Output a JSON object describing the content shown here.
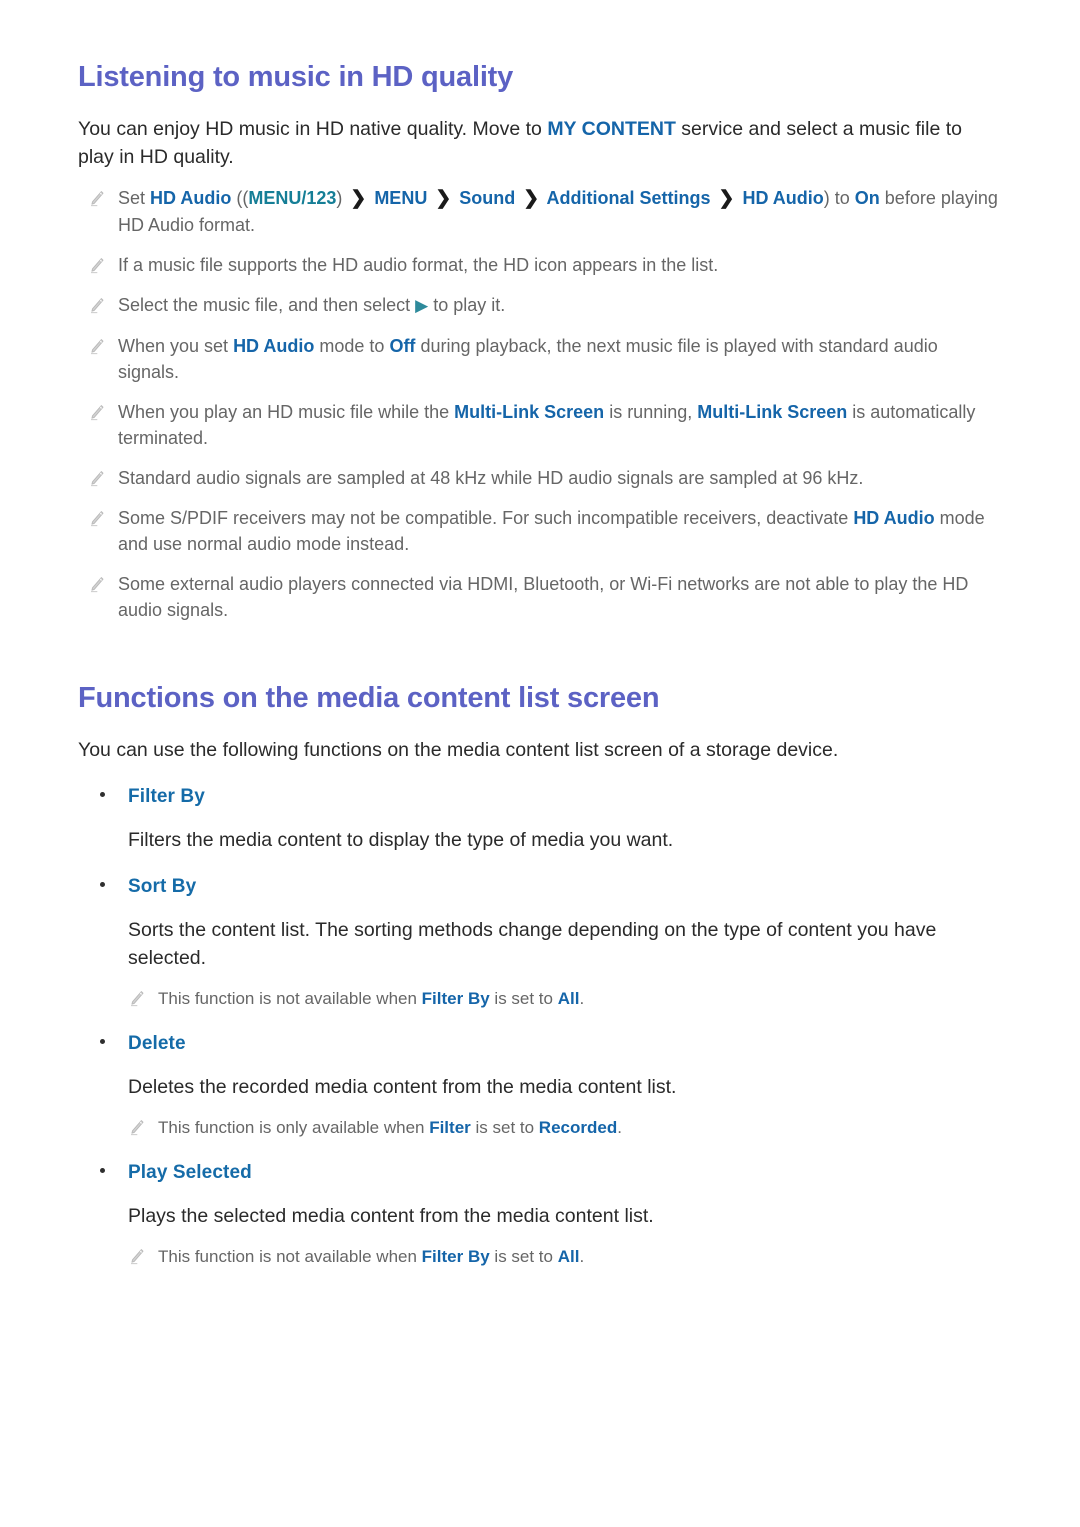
{
  "document": {
    "sections": [
      {
        "id": "listening-hd",
        "title": "Listening to music in HD quality",
        "intro_pre": "You can enjoy HD music in HD native quality. Move to ",
        "intro_kw": "MY CONTENT",
        "intro_post": " service and select a music file to play in HD quality.",
        "notes": [
          {
            "id": "note-set-hd-audio",
            "segments": [
              {
                "t": "Set ",
                "s": "plain"
              },
              {
                "t": "HD Audio",
                "s": "kw"
              },
              {
                "t": " ((",
                "s": "plain"
              },
              {
                "t": "MENU/123",
                "s": "kw-teal"
              },
              {
                "t": ") ",
                "s": "plain"
              },
              {
                "t": "❯",
                "s": "chev"
              },
              {
                "t": " MENU",
                "s": "kw"
              },
              {
                "t": " ",
                "s": "plain"
              },
              {
                "t": "❯",
                "s": "chev"
              },
              {
                "t": " Sound",
                "s": "kw"
              },
              {
                "t": " ",
                "s": "plain"
              },
              {
                "t": "❯",
                "s": "chev"
              },
              {
                "t": " Additional Settings",
                "s": "kw"
              },
              {
                "t": " ",
                "s": "plain"
              },
              {
                "t": "❯",
                "s": "chev"
              },
              {
                "t": " HD Audio",
                "s": "kw"
              },
              {
                "t": ") to ",
                "s": "plain"
              },
              {
                "t": "On",
                "s": "kw"
              },
              {
                "t": " before playing HD Audio format.",
                "s": "plain"
              }
            ]
          },
          {
            "id": "note-hd-icon",
            "segments": [
              {
                "t": "If a music file supports the HD audio format, the HD icon appears in the list.",
                "s": "plain"
              }
            ]
          },
          {
            "id": "note-select-play",
            "segments": [
              {
                "t": "Select the music file, and then select ",
                "s": "plain"
              },
              {
                "t": "▶",
                "s": "play-tri"
              },
              {
                "t": " to play it.",
                "s": "plain"
              }
            ]
          },
          {
            "id": "note-hd-audio-off",
            "segments": [
              {
                "t": "When you set ",
                "s": "plain"
              },
              {
                "t": "HD Audio",
                "s": "kw"
              },
              {
                "t": " mode to ",
                "s": "plain"
              },
              {
                "t": "Off",
                "s": "kw"
              },
              {
                "t": " during playback, the next music file is played with standard audio signals.",
                "s": "plain"
              }
            ]
          },
          {
            "id": "note-multi-link-screen",
            "segments": [
              {
                "t": "When you play an HD music file while the ",
                "s": "plain"
              },
              {
                "t": "Multi-Link Screen",
                "s": "kw"
              },
              {
                "t": " is running, ",
                "s": "plain"
              },
              {
                "t": "Multi-Link Screen",
                "s": "kw"
              },
              {
                "t": " is automatically terminated.",
                "s": "plain"
              }
            ]
          },
          {
            "id": "note-sampling-rates",
            "segments": [
              {
                "t": "Standard audio signals are sampled at 48 kHz while HD audio signals are sampled at 96 kHz.",
                "s": "plain"
              }
            ]
          },
          {
            "id": "note-spdif",
            "segments": [
              {
                "t": "Some S/PDIF receivers may not be compatible. For such incompatible receivers, deactivate ",
                "s": "plain"
              },
              {
                "t": "HD Audio",
                "s": "kw"
              },
              {
                "t": " mode and use normal audio mode instead.",
                "s": "plain"
              }
            ]
          },
          {
            "id": "note-external-players",
            "segments": [
              {
                "t": "Some external audio players connected via HDMI, Bluetooth, or Wi-Fi networks are not able to play the HD audio signals.",
                "s": "plain"
              }
            ]
          }
        ]
      },
      {
        "id": "media-content-functions",
        "title": "Functions on the media content list screen",
        "intro": "You can use the following functions on the media content list screen of a storage device.",
        "items": [
          {
            "id": "filter-by",
            "label": "Filter By",
            "description": "Filters the media content to display the type of media you want.",
            "notes": []
          },
          {
            "id": "sort-by",
            "label": "Sort By",
            "description": "Sorts the content list. The sorting methods change depending on the type of content you have selected.",
            "notes": [
              {
                "id": "note-sort-by-all",
                "segments": [
                  {
                    "t": "This function is not available when ",
                    "s": "plain"
                  },
                  {
                    "t": "Filter By",
                    "s": "kw"
                  },
                  {
                    "t": " is set to ",
                    "s": "plain"
                  },
                  {
                    "t": "All",
                    "s": "kw"
                  },
                  {
                    "t": ".",
                    "s": "plain"
                  }
                ]
              }
            ]
          },
          {
            "id": "delete",
            "label": "Delete",
            "description": "Deletes the recorded media content from the media content list.",
            "notes": [
              {
                "id": "note-delete-recorded",
                "segments": [
                  {
                    "t": "This function is only available when ",
                    "s": "plain"
                  },
                  {
                    "t": "Filter",
                    "s": "kw"
                  },
                  {
                    "t": " is set to ",
                    "s": "plain"
                  },
                  {
                    "t": "Recorded",
                    "s": "kw"
                  },
                  {
                    "t": ".",
                    "s": "plain"
                  }
                ]
              }
            ]
          },
          {
            "id": "play-selected",
            "label": "Play Selected",
            "description": "Plays the selected media content from the media content list.",
            "notes": [
              {
                "id": "note-play-selected-all",
                "segments": [
                  {
                    "t": "This function is not available when ",
                    "s": "plain"
                  },
                  {
                    "t": "Filter By",
                    "s": "kw"
                  },
                  {
                    "t": " is set to ",
                    "s": "plain"
                  },
                  {
                    "t": "All",
                    "s": "kw"
                  },
                  {
                    "t": ".",
                    "s": "plain"
                  }
                ]
              }
            ]
          }
        ]
      }
    ],
    "icons": {
      "note": "pencil-icon",
      "bullet": "bullet-dot",
      "breadcrumb_separator": "chevron-right-icon",
      "play": "play-triangle-icon"
    },
    "colors": {
      "heading": "#5c62c4",
      "keyword": "#1565a9",
      "keyword_teal": "#157e96",
      "bullet_label": "#156ba8",
      "body_text": "#2a2a2a",
      "note_text": "#666666",
      "background": "#ffffff"
    }
  }
}
